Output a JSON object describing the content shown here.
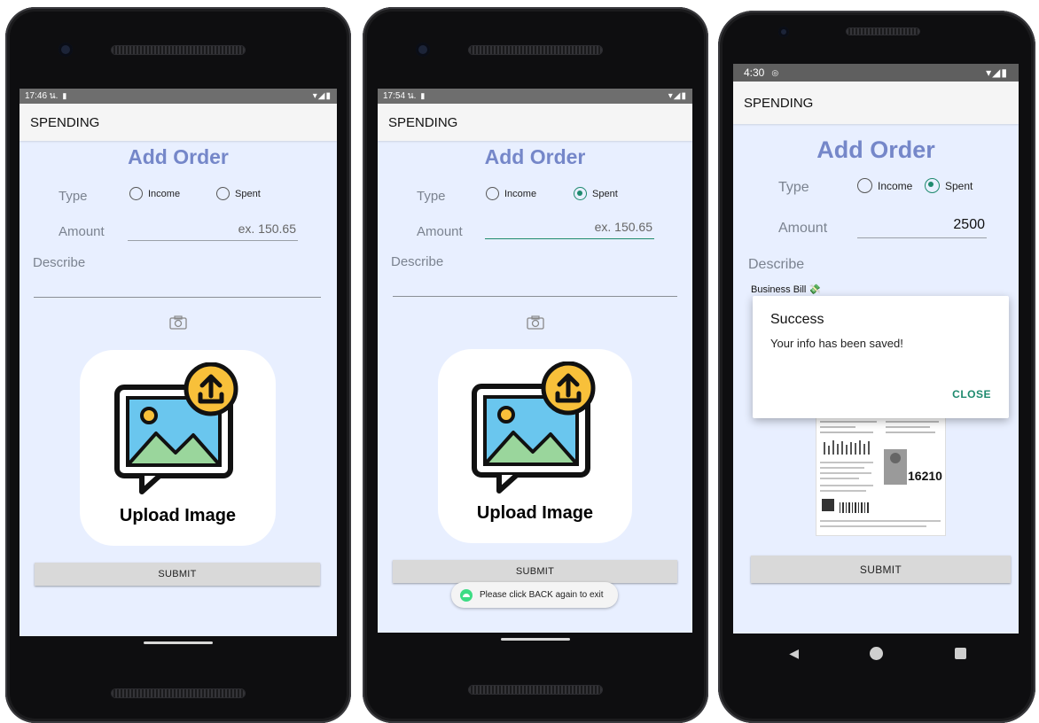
{
  "screens": [
    {
      "status_time": "17:46 น.",
      "app_title": "SPENDING",
      "heading": "Add Order",
      "type_label": "Type",
      "radio_income": "Income",
      "radio_spent": "Spent",
      "selected": "none",
      "amount_label": "Amount",
      "amount_value": "ex. 150.65",
      "describe_label": "Describe",
      "upload_label": "Upload Image",
      "submit_label": "SUBMIT"
    },
    {
      "status_time": "17:54 น.",
      "app_title": "SPENDING",
      "heading": "Add Order",
      "type_label": "Type",
      "radio_income": "Income",
      "radio_spent": "Spent",
      "selected": "Spent",
      "amount_label": "Amount",
      "amount_value": "ex. 150.65",
      "describe_label": "Describe",
      "upload_label": "Upload Image",
      "submit_label": "SUBMIT",
      "toast": "Please click BACK again to exit"
    },
    {
      "status_time": "4:30",
      "app_title": "SPENDING",
      "heading": "Add Order",
      "type_label": "Type",
      "radio_income": "Income",
      "radio_spent": "Spent",
      "selected": "Spent",
      "amount_label": "Amount",
      "amount_value": "2500",
      "describe_label": "Describe",
      "describe_value": "Business Bill 💸",
      "submit_label": "SUBMIT",
      "receipt_amount": "16210",
      "dialog": {
        "title": "Success",
        "message": "Your info has been saved!",
        "close_label": "CLOSE"
      }
    }
  ],
  "colors": {
    "heading": "#7587c9",
    "accent": "#1e8a6e",
    "screen_bg": "#e8efff"
  }
}
